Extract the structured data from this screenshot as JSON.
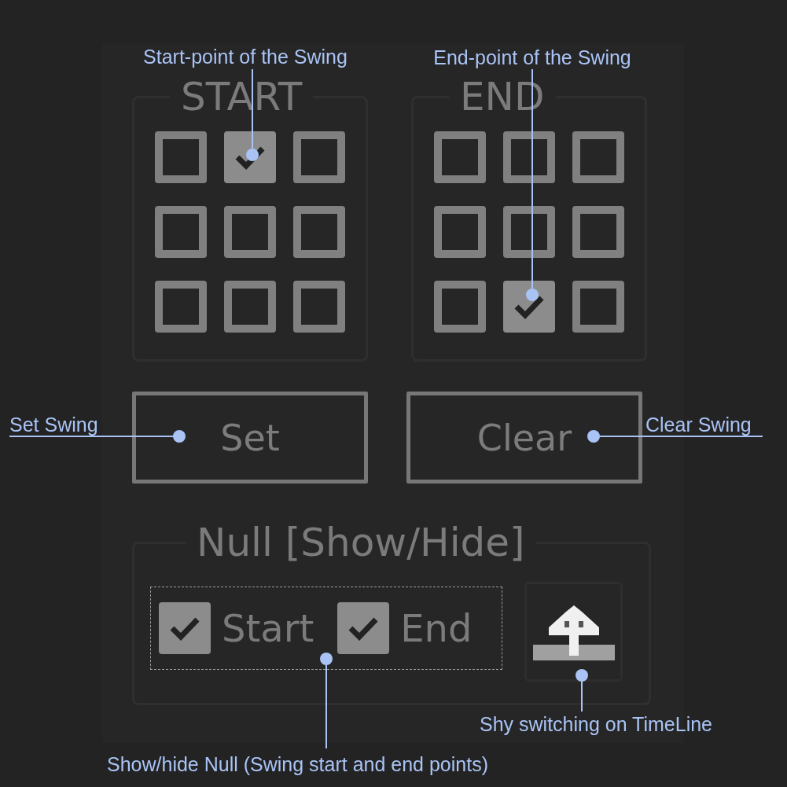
{
  "panel": {
    "start_group": {
      "title": "START",
      "cells": [
        {
          "checked": false
        },
        {
          "checked": true
        },
        {
          "checked": false
        },
        {
          "checked": false
        },
        {
          "checked": false
        },
        {
          "checked": false
        },
        {
          "checked": false
        },
        {
          "checked": false
        },
        {
          "checked": false
        }
      ]
    },
    "end_group": {
      "title": "END",
      "cells": [
        {
          "checked": false
        },
        {
          "checked": false
        },
        {
          "checked": false
        },
        {
          "checked": false
        },
        {
          "checked": false
        },
        {
          "checked": false
        },
        {
          "checked": false
        },
        {
          "checked": true
        },
        {
          "checked": false
        }
      ]
    },
    "buttons": [
      "Set",
      "Clear"
    ],
    "null_group": {
      "title": "Null [Show/Hide]",
      "toggles": [
        {
          "label": "Start",
          "checked": true
        },
        {
          "label": "End",
          "checked": true
        }
      ]
    }
  },
  "annotations": [
    {
      "text": "Start-point of the Swing"
    },
    {
      "text": "End-point of the Swing"
    },
    {
      "text": "Set Swing"
    },
    {
      "text": "Clear Swing"
    },
    {
      "text": "Shy switching on TimeLine"
    },
    {
      "text": "Show/hide Null (Swing start and end points)"
    }
  ]
}
